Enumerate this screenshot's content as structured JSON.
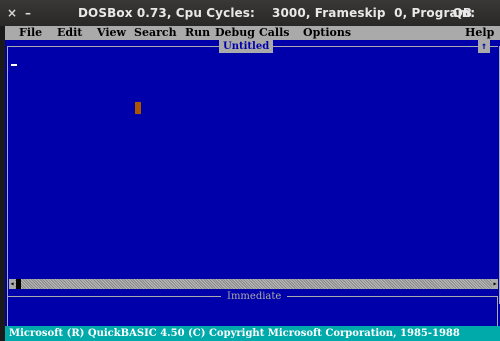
{
  "window": {
    "title": "DOSBox 0.73, Cpu Cycles:    3000, Frameskip  0, Program:",
    "program": "QB",
    "close_glyph": "×",
    "minimize_glyph": "–"
  },
  "menu": {
    "items": [
      {
        "label": "File"
      },
      {
        "label": "Edit"
      },
      {
        "label": "View"
      },
      {
        "label": "Search"
      },
      {
        "label": "Run"
      },
      {
        "label": "Debug"
      },
      {
        "label": "Calls"
      },
      {
        "label": "Options"
      },
      {
        "label": "Help"
      }
    ]
  },
  "editor": {
    "document_title": "Untitled",
    "maximize_glyph": "↑",
    "cursor_glyph": "–"
  },
  "immediate": {
    "title": "Immediate"
  },
  "statusbar": {
    "text": "Microsoft (R) QuickBASIC 4.50 (C) Copyright Microsoft Corporation, 1985-1988"
  },
  "colors": {
    "background": "#0000aa",
    "menu": "#aaaaaa",
    "status": "#00aaaa",
    "mouse_cursor": "#aa5500"
  }
}
